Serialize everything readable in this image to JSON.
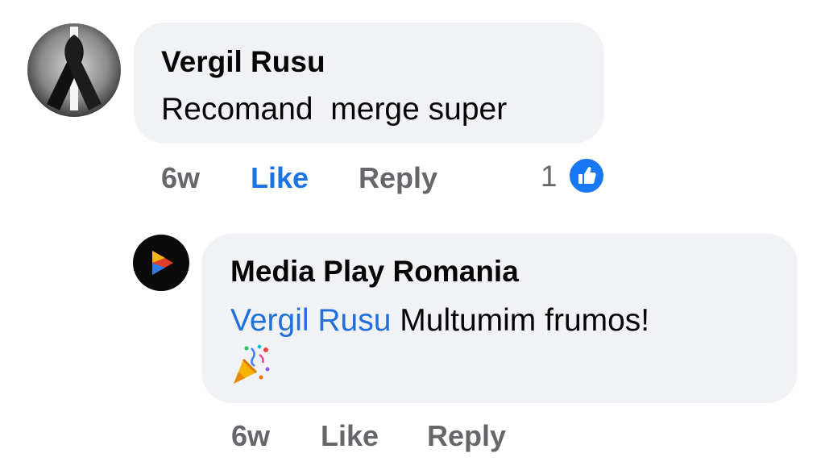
{
  "comments": [
    {
      "author": "Vergil Rusu",
      "text": "Recomand  merge super",
      "time": "6w",
      "like_label": "Like",
      "reply_label": "Reply",
      "reaction_count": "1",
      "reaction_icon": "thumbs-up-icon",
      "liked": true
    },
    {
      "author": "Media Play Romania",
      "mention": "Vergil Rusu",
      "text": " Multumim frumos!",
      "emoji": "party-popper",
      "time": "6w",
      "like_label": "Like",
      "reply_label": "Reply",
      "liked": false
    }
  ],
  "colors": {
    "bubble": "#f0f2f5",
    "link": "#216fdb",
    "liked": "#1b74e4",
    "muted": "#65676b",
    "reaction_badge": "#1877f2"
  }
}
